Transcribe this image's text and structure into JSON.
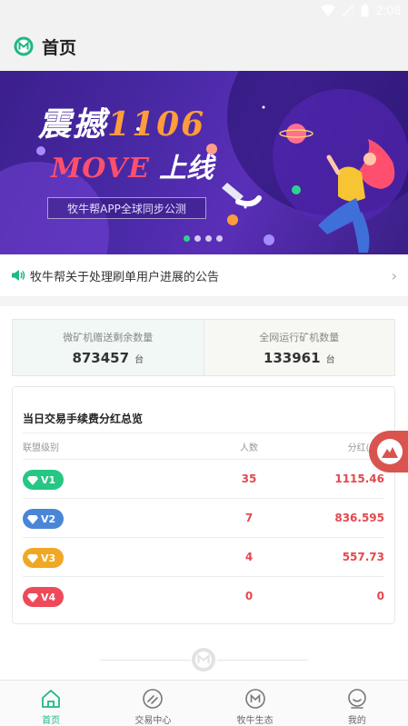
{
  "status_bar": {
    "time": "2:08"
  },
  "header": {
    "title": "首页"
  },
  "banner": {
    "title_cn": "震撼",
    "title_num": "1106",
    "title_en": "MOVE",
    "title_cn2": "上线",
    "subtitle": "牧牛帮APP全球同步公测",
    "active_slide": 1,
    "slide_count": 4
  },
  "notice": {
    "text": "牧牛帮关于处理刷单用户进展的公告"
  },
  "stats": {
    "left": {
      "label": "微矿机赠送剩余数量",
      "value": "873457",
      "unit": "台"
    },
    "right": {
      "label": "全网运行矿机数量",
      "value": "133961",
      "unit": "台"
    }
  },
  "dividend": {
    "title": "当日交易手续费分红总览",
    "columns": [
      "联盟级别",
      "人数",
      "分红(MO"
    ],
    "rows": [
      {
        "level": "V1",
        "count": "35",
        "bonus": "1115.46",
        "color": "#25c783"
      },
      {
        "level": "V2",
        "count": "7",
        "bonus": "836.595",
        "color": "#4a86d8"
      },
      {
        "level": "V3",
        "count": "4",
        "bonus": "557.73",
        "color": "#f0a824"
      },
      {
        "level": "V4",
        "count": "0",
        "bonus": "0",
        "color": "#ee4a5a"
      }
    ]
  },
  "tabbar": {
    "items": [
      {
        "label": "首页",
        "icon": "home-icon",
        "active": true
      },
      {
        "label": "交易中心",
        "icon": "trade-icon",
        "active": false
      },
      {
        "label": "牧牛生态",
        "icon": "ecology-icon",
        "active": false
      },
      {
        "label": "我的",
        "icon": "profile-icon",
        "active": false
      }
    ]
  },
  "colors": {
    "accent": "#21b786",
    "danger": "#e4484e",
    "fab": "#d9544f"
  }
}
